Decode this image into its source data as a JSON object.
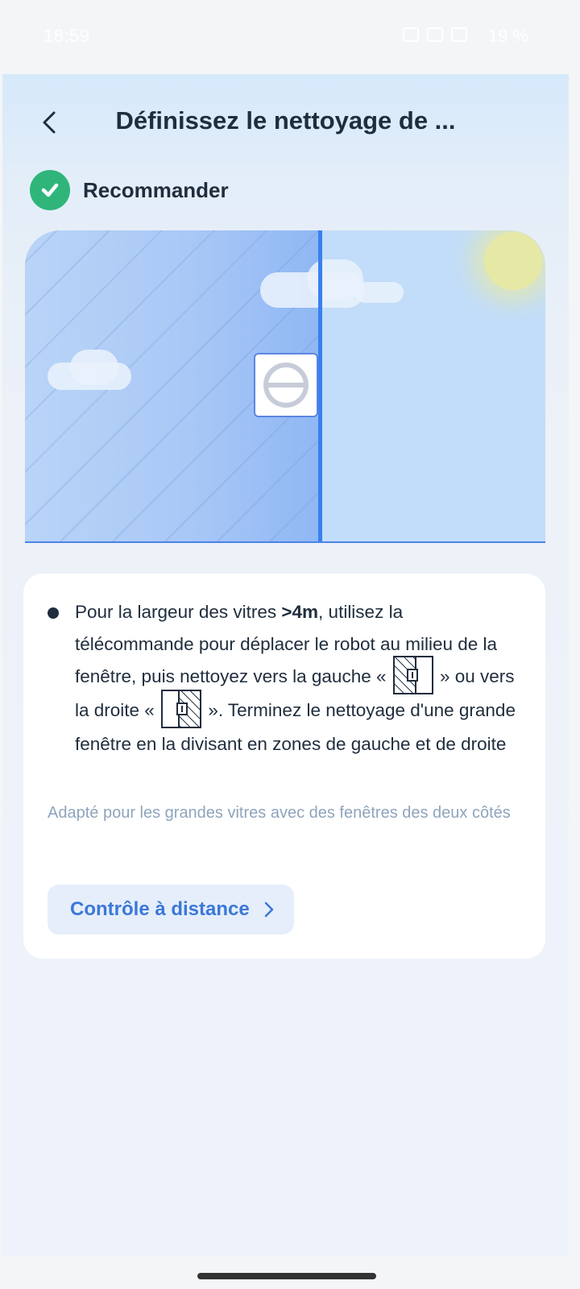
{
  "status_bar": {
    "time": "18:59",
    "battery": "19 %"
  },
  "header": {
    "title": "Définissez le nettoyage de ..."
  },
  "recommend": {
    "label": "Recommander"
  },
  "info": {
    "line_prefix": "Pour la largeur des vitres ",
    "bold": ">4m",
    "line_middle": ", utilisez la télécommande pour déplacer le robot au milieu de la fenêtre, puis nettoyez vers la gauche « ",
    "left_close": " » ou vers la droite « ",
    "right_close": " ». Terminez le nettoyage d'une grande fenêtre en la divisant en zones de gauche et de droite",
    "note": "Adapté pour les grandes vitres avec des fenêtres des deux côtés"
  },
  "remote_button": {
    "label": "Contrôle à distance"
  },
  "colors": {
    "accent": "#3a78d8",
    "check": "#2fb57a",
    "divider": "#3a7ff0"
  }
}
